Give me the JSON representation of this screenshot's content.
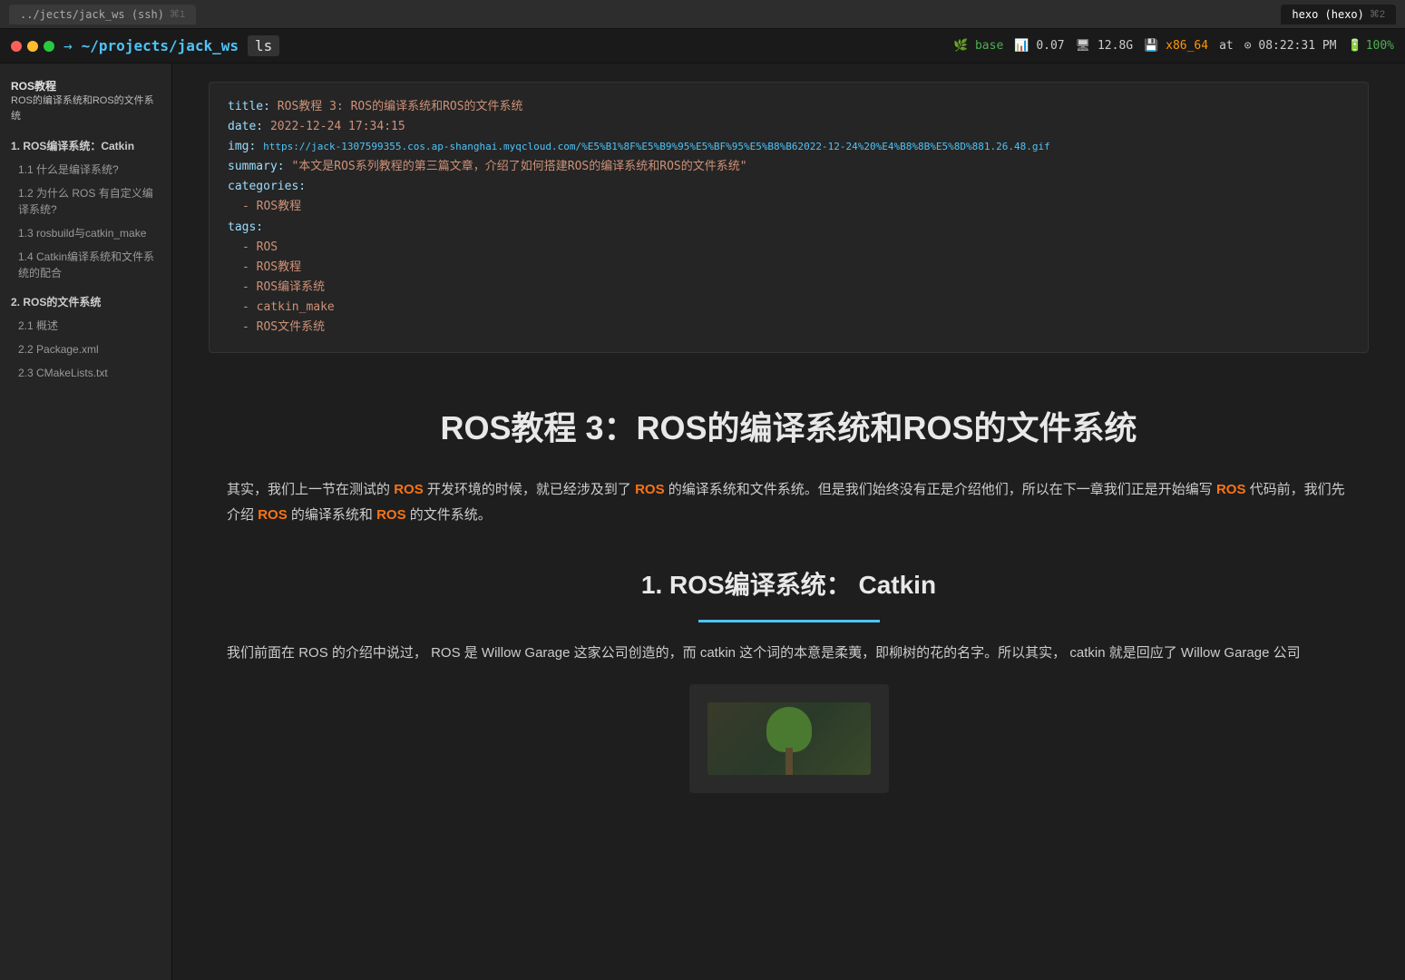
{
  "tabs": {
    "left_tab": {
      "path": "../jects/jack_ws (ssh)",
      "shortcut": "⌘1"
    },
    "right_tab": {
      "label": "hexo (hexo)",
      "shortcut": "⌘2"
    }
  },
  "terminal": {
    "prompt_symbol": "→",
    "tilde": "~",
    "path": "/projects/jack_ws",
    "ssh_label": "(ssh)",
    "command": "ls",
    "status": {
      "base_label": "base",
      "cpu_icon": "📈",
      "cpu_val": "0.07",
      "mem_icon": "🖥",
      "mem_val": "12.8G",
      "arch_icon": "💾",
      "arch_val": "x86_64",
      "at": "at",
      "clock_icon": "⊙",
      "time": "08:22:31 PM",
      "battery_icon": "🔋",
      "battery_val": "100%"
    }
  },
  "sidebar": {
    "breadcrumb": "ROS教程",
    "title": "ROS的编译系统和ROS的文件系统",
    "items": [
      {
        "label": "1. ROS编译系统：Catkin",
        "level": "section"
      },
      {
        "label": "1.1 什么是编译系统?",
        "level": "sub"
      },
      {
        "label": "1.2 为什么 ROS 有自定义编译系统?",
        "level": "sub"
      },
      {
        "label": "1.3 rosbuild与catkin_make",
        "level": "sub"
      },
      {
        "label": "1.4 Catkin编译系统和文件系统的配合",
        "level": "sub"
      },
      {
        "label": "2. ROS的文件系统",
        "level": "section"
      },
      {
        "label": "2.1 概述",
        "level": "sub"
      },
      {
        "label": "2.2 Package.xml",
        "level": "sub"
      },
      {
        "label": "2.3 CMakeLists.txt",
        "level": "sub"
      }
    ]
  },
  "yaml_block": {
    "title_key": "title",
    "title_val": "ROS教程 3: ROS的编译系统和ROS的文件系统",
    "date_key": "date",
    "date_val": "2022-12-24 17:34:15",
    "img_key": "img",
    "img_url": "https://jack-1307599355.cos.ap-shanghai.myqcloud.com/%E5%B1%8F%E5%B9%95%E5%BF%95%E5%B8%B62022-12-24%20%E4%B8%8B%E5%8D%881.26.48.gif",
    "summary_key": "summary",
    "summary_val": "本文是ROS系列教程的第三篇文章，介绍了如何搭建ROS的编译系统和ROS的文件系统",
    "categories_key": "categories",
    "cat_item": "- ROS教程",
    "tags_key": "tags",
    "tag1": "- ROS",
    "tag2": "- ROS教程",
    "tag3": "- ROS编译系统",
    "tag4": "- catkin_make",
    "tag5": "- ROS文件系统"
  },
  "article": {
    "main_title": "ROS教程 3：ROS的编译系统和ROS的文件系统",
    "intro_p1": "其实，我们上一节在测试的",
    "intro_ros1": "ROS",
    "intro_p2": "开发环境的时候，就已经涉及到了",
    "intro_ros2": "ROS",
    "intro_p3": "的编译系统和文件系统。但是我们始终没有正是介绍他们，所以在下一章我们正是开始编写",
    "intro_ros3": "ROS",
    "intro_p4": "代码前，我们先介绍",
    "intro_ros4": "ROS",
    "intro_p5": "的编译系统和",
    "intro_ros5": "ROS",
    "intro_p6": "的文件系统。",
    "section1_title": "1. ROS编译系统：  Catkin",
    "section1_body1_p1": "我们前面在",
    "section1_ros1": "ROS",
    "section1_body1_p2": "的介绍中说过，",
    "section1_ros2": "ROS 是",
    "section1_willow": "Willow Garage",
    "section1_body1_p3": "这家公司创造的，而",
    "section1_catkin1": "catkin",
    "section1_body1_p4": "这个词的本意是柔荑，即柳树的花的名字。所以其实，",
    "section1_catkin2": "catkin",
    "section1_body1_p5": "就是回应了",
    "section1_willow2": "Willow Garage",
    "section1_body1_p6": "公司"
  }
}
